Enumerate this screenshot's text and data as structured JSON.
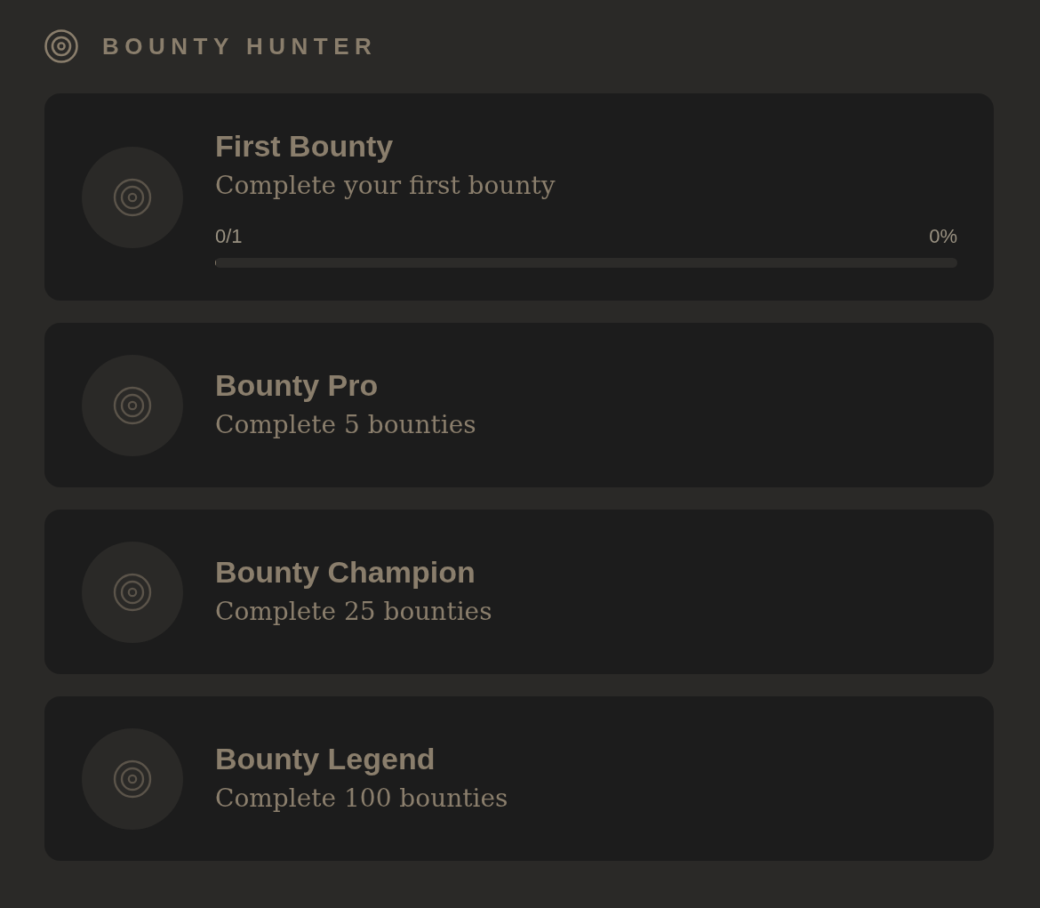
{
  "header": {
    "title": "BOUNTY HUNTER"
  },
  "achievements": [
    {
      "title": "First Bounty",
      "description": "Complete your first bounty",
      "progress": {
        "count": "0/1",
        "percent": "0%",
        "level": 0
      }
    },
    {
      "title": "Bounty Pro",
      "description": "Complete 5 bounties"
    },
    {
      "title": "Bounty Champion",
      "description": "Complete 25 bounties"
    },
    {
      "title": "Bounty Legend",
      "description": "Complete 100 bounties"
    }
  ]
}
